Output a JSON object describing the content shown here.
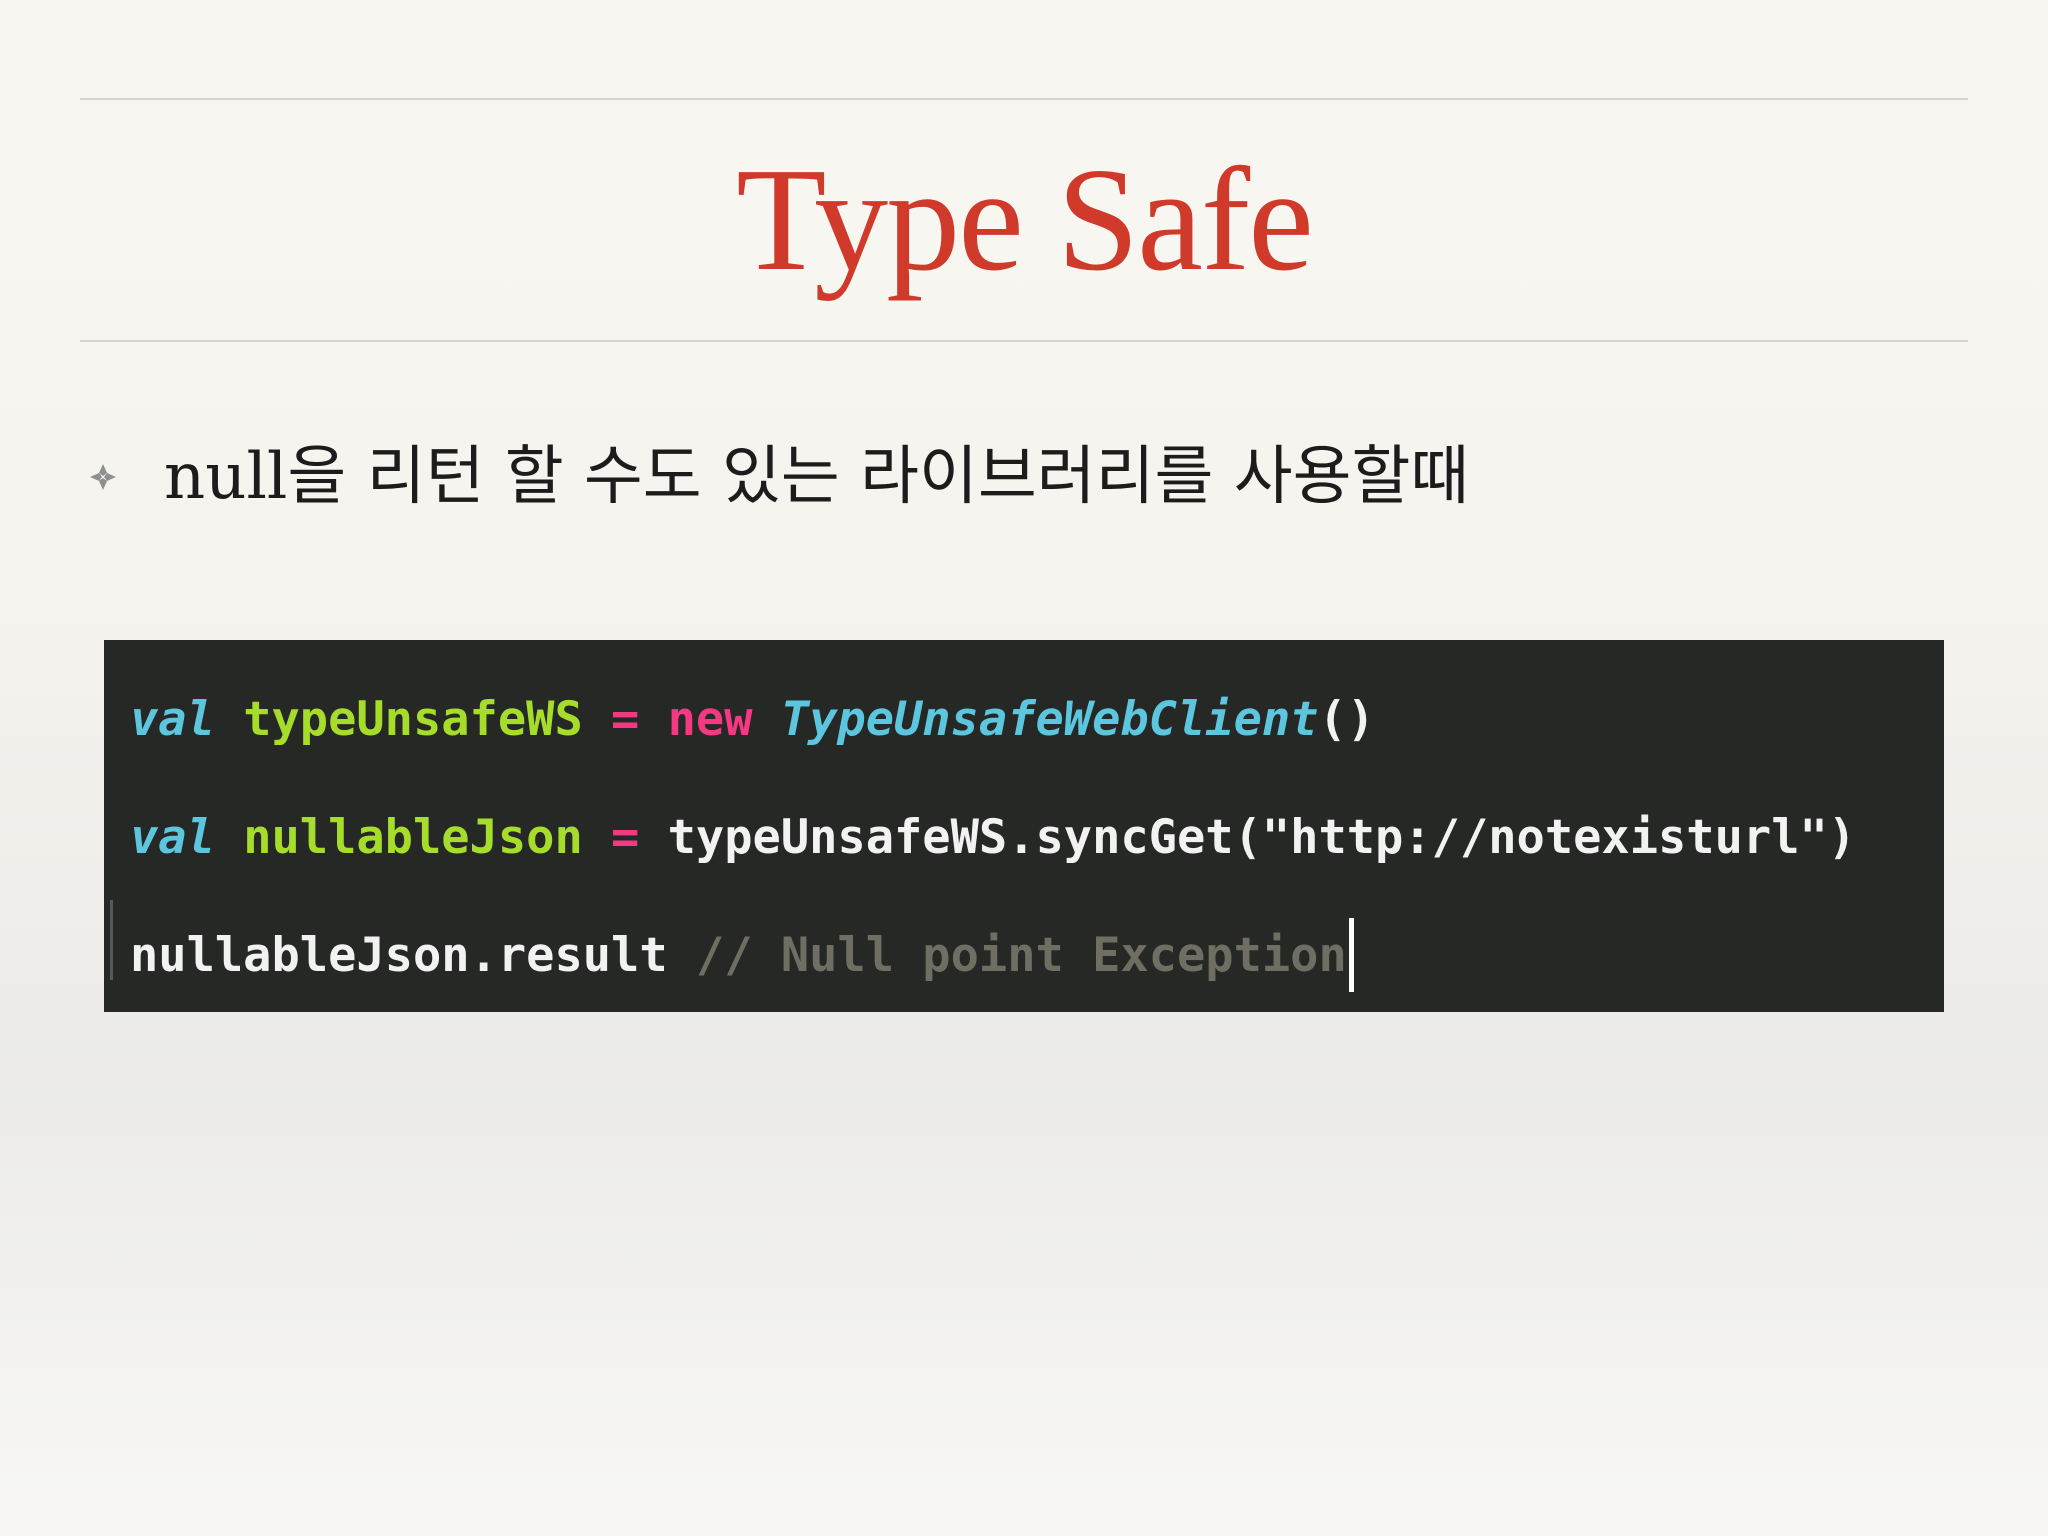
{
  "slide": {
    "title": "Type Safe",
    "bullet": {
      "icon": "fleuron-diamond-icon",
      "text": "null을 리턴 할 수도 있는 라이브러리를 사용할때"
    }
  },
  "code": {
    "colors": {
      "background": "#262826",
      "keyword": "#5cc6de",
      "identifier": "#a6dc2a",
      "operator": "#f53882",
      "plain": "#f2f2f2",
      "comment": "#6f6e63"
    },
    "line1": {
      "kw": "val",
      "name": "typeUnsafeWS",
      "eq": "=",
      "new_kw": "new",
      "class_name": "TypeUnsafeWebClient",
      "parens": "()"
    },
    "line2": {
      "kw": "val",
      "name": "nullableJson",
      "eq": "=",
      "call": "typeUnsafeWS.syncGet(\"http://notexisturl\")"
    },
    "line3": {
      "expr": "nullableJson.result",
      "comment": "// Null point Exception"
    }
  }
}
